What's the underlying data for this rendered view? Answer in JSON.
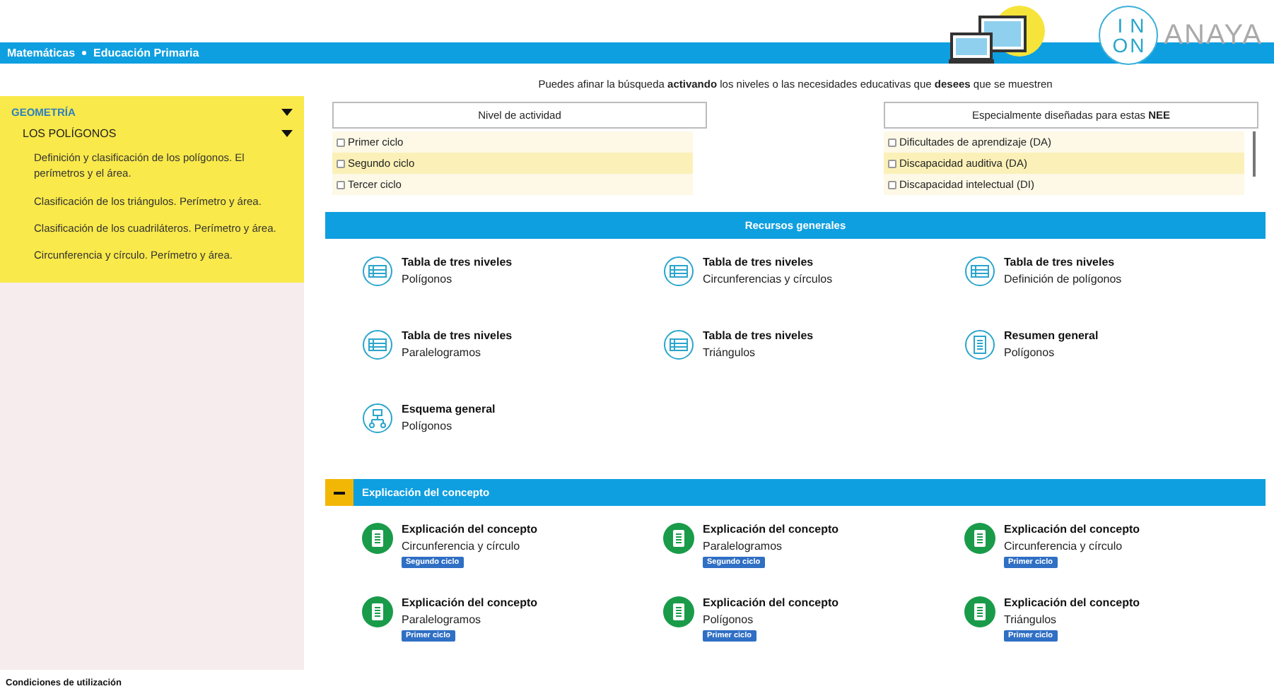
{
  "header": {
    "breadcrumb": [
      "Matemáticas",
      "Educación Primaria"
    ],
    "logo": {
      "letters": [
        "I",
        "N",
        "O",
        "N"
      ],
      "brand": "ANAYA"
    }
  },
  "sidebar": {
    "items": [
      {
        "label": "GEOMETRÍA",
        "expanded": true,
        "children": [
          {
            "label": "LOS POLÍGONOS",
            "expanded": true,
            "children": [
              {
                "label": "Definición y clasificación de los polígonos. El perímetros y el área."
              },
              {
                "label": "Clasificación de los triángulos. Perímetro y área."
              },
              {
                "label": "Clasificación de los cuadriláteros. Perímetro y área."
              },
              {
                "label": "Circunferencia y círculo. Perímetro y área."
              }
            ]
          }
        ]
      }
    ]
  },
  "intro": "Puedes afinar la búsqueda **activando** los niveles o las necesidades educativas que **desees** que se muestren",
  "filters": [
    {
      "title": "Nivel de actividad",
      "options": [
        {
          "label": "Primer ciclo",
          "checked": false,
          "highlighted": false
        },
        {
          "label": "Segundo ciclo",
          "checked": false,
          "highlighted": true
        },
        {
          "label": "Tercer ciclo",
          "checked": false,
          "highlighted": false
        }
      ]
    },
    {
      "title": "Especialmente diseñadas para estas **NEE**",
      "scrollable": true,
      "options": [
        {
          "label": "Dificultades de aprendizaje (DA)",
          "checked": false,
          "highlighted": false
        },
        {
          "label": "Discapacidad auditiva (DA)",
          "checked": false,
          "highlighted": true
        },
        {
          "label": "Discapacidad intelectual (DI)",
          "checked": false,
          "highlighted": false
        }
      ]
    }
  ],
  "sections": [
    {
      "title": "Recursos generales",
      "collapsible": false,
      "items": [
        {
          "kind": "table",
          "title": "Tabla de tres niveles",
          "subtitle": "Polígonos"
        },
        {
          "kind": "table",
          "title": "Tabla de tres niveles",
          "subtitle": "Circunferencias y círculos"
        },
        {
          "kind": "table",
          "title": "Tabla de tres niveles",
          "subtitle": "Definición de polígonos"
        },
        {
          "kind": "table",
          "title": "Tabla de tres niveles",
          "subtitle": "Paralelogramos"
        },
        {
          "kind": "table",
          "title": "Tabla de tres niveles",
          "subtitle": "Triángulos"
        },
        {
          "kind": "summary",
          "title": "Resumen general",
          "subtitle": "Polígonos"
        },
        {
          "kind": "diagram",
          "title": "Esquema general",
          "subtitle": "Polígonos"
        }
      ]
    },
    {
      "title": "Explicación del concepto",
      "collapsible": true,
      "expanded": true,
      "items": [
        {
          "kind": "document",
          "title": "Explicación del concepto",
          "subtitle": "Circunferencia y círculo",
          "badge": "Segundo ciclo"
        },
        {
          "kind": "document",
          "title": "Explicación del concepto",
          "subtitle": "Paralelogramos",
          "badge": "Segundo ciclo"
        },
        {
          "kind": "document",
          "title": "Explicación del concepto",
          "subtitle": "Circunferencia y círculo",
          "badge": "Primer ciclo"
        },
        {
          "kind": "document",
          "title": "Explicación del concepto",
          "subtitle": "Paralelogramos",
          "badge": "Primer ciclo"
        },
        {
          "kind": "document",
          "title": "Explicación del concepto",
          "subtitle": "Polígonos",
          "badge": "Primer ciclo"
        },
        {
          "kind": "document",
          "title": "Explicación del concepto",
          "subtitle": "Triángulos",
          "badge": "Primer ciclo"
        }
      ]
    }
  ],
  "footer": {
    "link": "Condiciones de utilización"
  }
}
